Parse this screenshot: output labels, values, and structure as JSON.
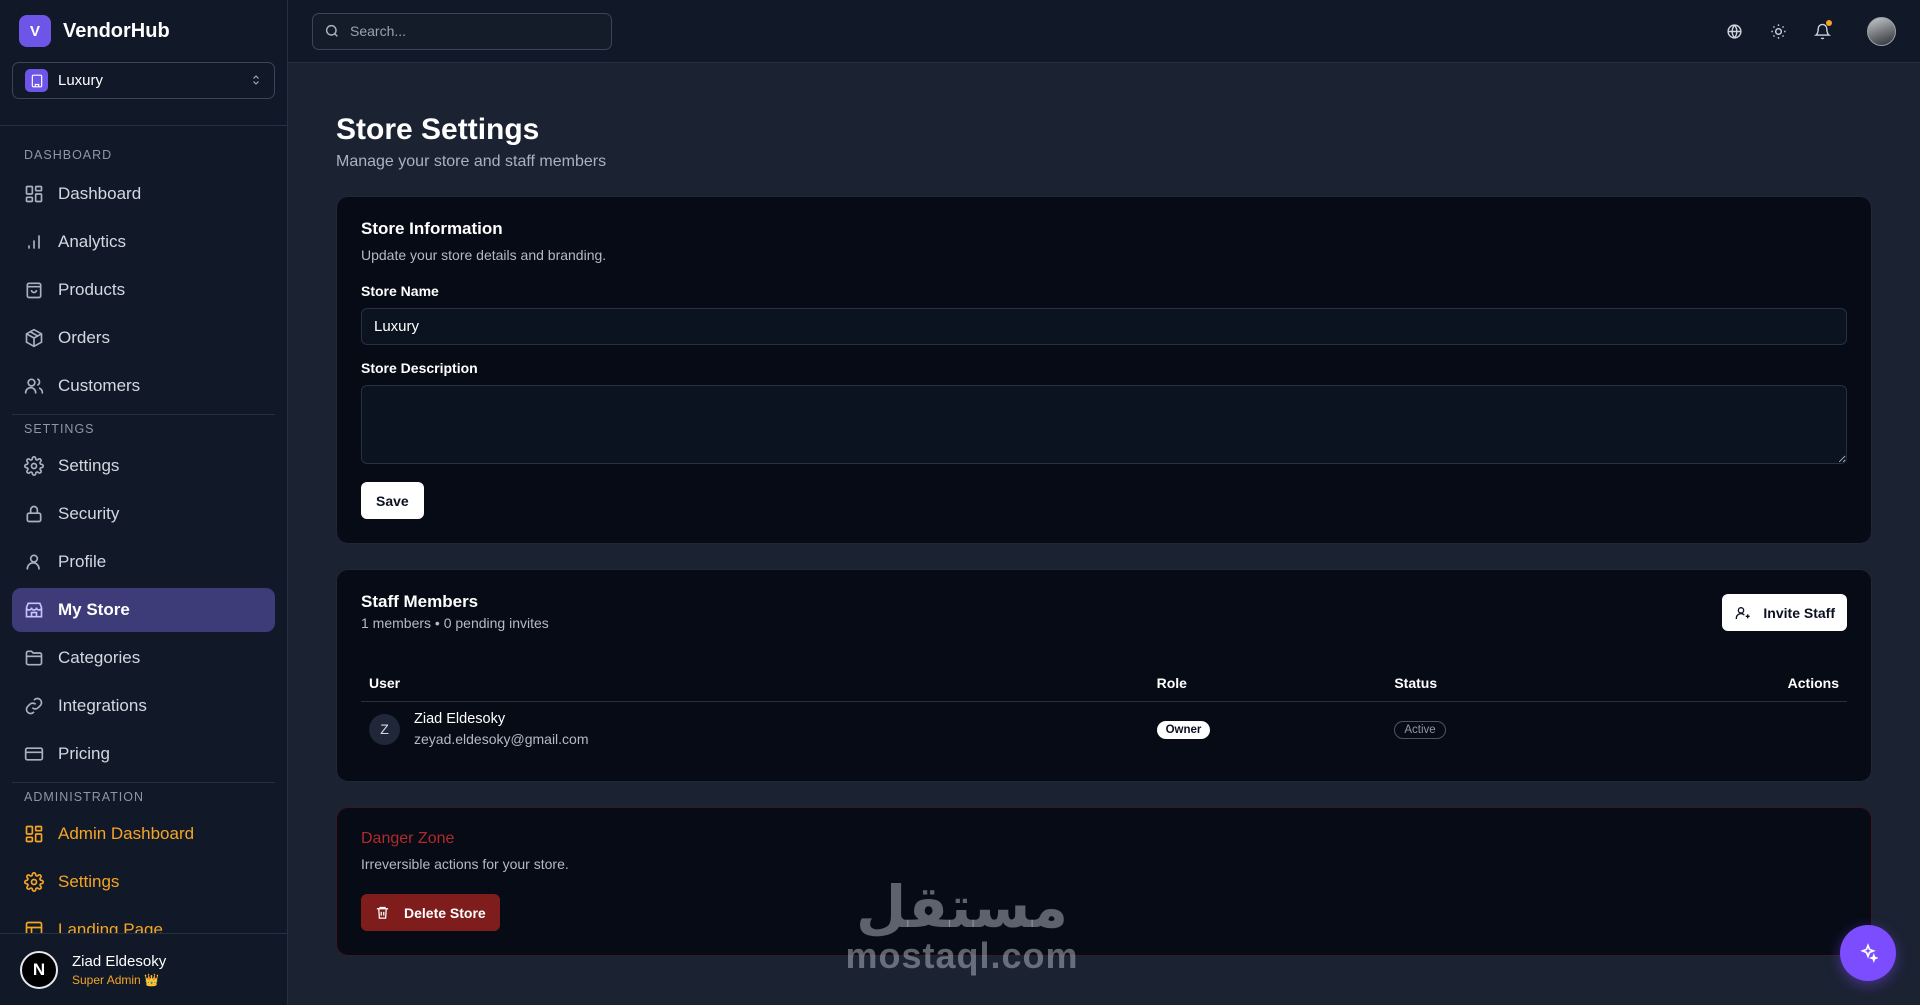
{
  "brand": {
    "name": "VendorHub",
    "logo_letter": "V",
    "accent_color": "#6d55e8"
  },
  "store_switcher": {
    "selected": "Luxury"
  },
  "sidebar": {
    "sections": [
      {
        "title": "DASHBOARD",
        "items": [
          {
            "label": "Dashboard",
            "icon": "grid-icon"
          },
          {
            "label": "Analytics",
            "icon": "bar-chart-icon"
          },
          {
            "label": "Products",
            "icon": "shopping-bag-icon"
          },
          {
            "label": "Orders",
            "icon": "package-icon"
          },
          {
            "label": "Customers",
            "icon": "users-icon"
          }
        ]
      },
      {
        "title": "SETTINGS",
        "items": [
          {
            "label": "Settings",
            "icon": "gear-icon"
          },
          {
            "label": "Security",
            "icon": "lock-icon"
          },
          {
            "label": "Profile",
            "icon": "user-icon"
          },
          {
            "label": "My Store",
            "icon": "store-icon",
            "active": true
          },
          {
            "label": "Categories",
            "icon": "folder-icon"
          },
          {
            "label": "Integrations",
            "icon": "link-icon"
          },
          {
            "label": "Pricing",
            "icon": "credit-card-icon"
          }
        ]
      },
      {
        "title": "ADMINISTRATION",
        "color": "#f5a524",
        "items": [
          {
            "label": "Admin Dashboard",
            "icon": "grid-icon"
          },
          {
            "label": "Settings",
            "icon": "gear-icon"
          },
          {
            "label": "Landing Page",
            "icon": "layout-icon"
          }
        ]
      }
    ],
    "user": {
      "initial": "N",
      "name": "Ziad Eldesoky",
      "role": "Super Admin 👑"
    }
  },
  "topbar": {
    "search_placeholder": "Search...",
    "icons": [
      "globe-icon",
      "sun-icon",
      "bell-icon",
      "profile-avatar"
    ],
    "notification_dot_color": "#f5a524"
  },
  "page": {
    "title": "Store Settings",
    "subtitle": "Manage your store and staff members"
  },
  "store_info": {
    "title": "Store Information",
    "description": "Update your store details and branding.",
    "name_label": "Store Name",
    "name_value": "Luxury",
    "desc_label": "Store Description",
    "desc_value": "",
    "save_label": "Save"
  },
  "staff": {
    "title": "Staff Members",
    "summary": "1 members • 0 pending invites",
    "invite_label": "Invite Staff",
    "columns": [
      "User",
      "Role",
      "Status",
      "Actions"
    ],
    "rows": [
      {
        "initial": "Z",
        "name": "Ziad Eldesoky",
        "email": "zeyad.eldesoky@gmail.com",
        "role": "Owner",
        "status": "Active"
      }
    ]
  },
  "danger": {
    "title": "Danger Zone",
    "description": "Irreversible actions for your store.",
    "delete_label": "Delete Store",
    "color": "#b02a2a"
  },
  "watermark": {
    "arabic": "مستقل",
    "latin": "mostaql.com"
  },
  "fab": {
    "icon": "sparkles-icon",
    "color": "#7c4dff"
  }
}
